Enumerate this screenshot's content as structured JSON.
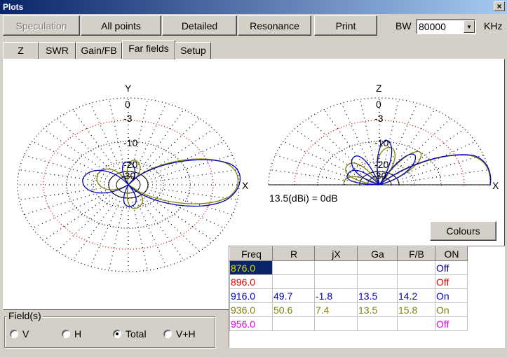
{
  "window": {
    "title": "Plots",
    "close_glyph": "×"
  },
  "toolbar": {
    "buttons": [
      "Speculation",
      "All points",
      "Detailed",
      "Resonance",
      "Print"
    ],
    "bw_label": "BW",
    "bw_value": "80000",
    "bw_unit": "KHz"
  },
  "tabs": [
    "Z",
    "SWR",
    "Gain/FB",
    "Far fields",
    "Setup"
  ],
  "active_tab": "Far fields",
  "plot": {
    "horizontal": {
      "axis_top": "Y",
      "axis_right": "X"
    },
    "vertical": {
      "axis_top": "Z",
      "axis_right": "X"
    },
    "ring_labels": [
      "0",
      "-3",
      "-10",
      "-20",
      "-30"
    ],
    "ref_text": "13.5(dBi) = 0dB",
    "colours_button": "Colours"
  },
  "table": {
    "headers": [
      "Freq",
      "R",
      "jX",
      "Ga",
      "F/B",
      "ON"
    ],
    "rows": [
      {
        "freq": "876.0",
        "r": "",
        "jx": "",
        "ga": "",
        "fb": "",
        "on": "Off",
        "color": "#000080",
        "selected": true
      },
      {
        "freq": "896.0",
        "r": "",
        "jx": "",
        "ga": "",
        "fb": "",
        "on": "Off",
        "color": "#e00000"
      },
      {
        "freq": "916.0",
        "r": "49.7",
        "jx": "-1.8",
        "ga": "13.5",
        "fb": "14.2",
        "on": "On",
        "color": "#0000c0"
      },
      {
        "freq": "936.0",
        "r": "50.6",
        "jx": "7.4",
        "ga": "13.5",
        "fb": "15.8",
        "on": "On",
        "color": "#808000"
      },
      {
        "freq": "956.0",
        "r": "",
        "jx": "",
        "ga": "",
        "fb": "",
        "on": "Off",
        "color": "#e000e0"
      }
    ]
  },
  "fields": {
    "legend": "Field(s)",
    "options": [
      "V",
      "H",
      "Total",
      "V+H"
    ],
    "selected": "Total"
  },
  "colors": {
    "trace_a": "#0000c0",
    "trace_b": "#808000",
    "ref_ring": "#e00000"
  }
}
